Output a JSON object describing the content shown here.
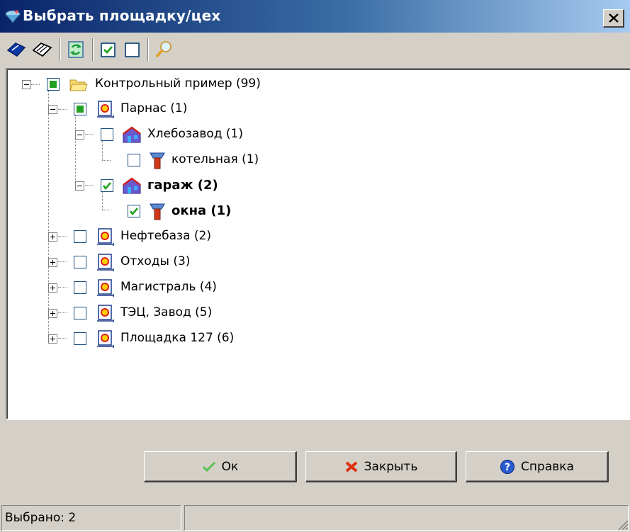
{
  "window": {
    "title": "Выбрать площадку/цех",
    "close_icon": "close-icon"
  },
  "toolbar": {
    "buttons": [
      {
        "name": "check-all-icon",
        "color": "#0a3aa8"
      },
      {
        "name": "uncheck-all-icon"
      },
      {
        "name": "refresh-icon",
        "color": "#1a9a3a"
      },
      {
        "name": "checkbox-checked-icon"
      },
      {
        "name": "checkbox-empty-icon"
      },
      {
        "name": "search-icon"
      }
    ]
  },
  "tree": {
    "nodes": [
      {
        "label": "Контрольный пример (99)",
        "level": 0,
        "expanded": true,
        "check": "partial",
        "icon": "folder-icon",
        "bold": false
      },
      {
        "label": "Парнас (1)",
        "level": 1,
        "expanded": true,
        "check": "partial",
        "icon": "site-icon",
        "bold": false
      },
      {
        "label": "Хлебозавод (1)",
        "level": 2,
        "expanded": true,
        "check": "unchecked",
        "icon": "building-icon",
        "bold": false
      },
      {
        "label": "котельная (1)",
        "level": 3,
        "expanded": null,
        "check": "unchecked",
        "icon": "pipe-icon",
        "bold": false
      },
      {
        "label": "гараж (2)",
        "level": 2,
        "expanded": true,
        "check": "checked",
        "icon": "building-icon",
        "bold": true
      },
      {
        "label": "окна (1)",
        "level": 3,
        "expanded": null,
        "check": "checked",
        "icon": "pipe-icon",
        "bold": true
      },
      {
        "label": "Нефтебаза (2)",
        "level": 1,
        "expanded": false,
        "check": "unchecked",
        "icon": "site-icon",
        "bold": false
      },
      {
        "label": "Отходы (3)",
        "level": 1,
        "expanded": false,
        "check": "unchecked",
        "icon": "site-icon",
        "bold": false
      },
      {
        "label": "Магистраль (4)",
        "level": 1,
        "expanded": false,
        "check": "unchecked",
        "icon": "site-icon",
        "bold": false
      },
      {
        "label": "ТЭЦ, Завод (5)",
        "level": 1,
        "expanded": false,
        "check": "unchecked",
        "icon": "site-icon",
        "bold": false
      },
      {
        "label": "Площадка 127 (6)",
        "level": 1,
        "expanded": false,
        "check": "unchecked",
        "icon": "site-icon",
        "bold": false
      }
    ]
  },
  "buttons": {
    "ok_label": "Ок",
    "close_label": "Закрыть",
    "help_label": "Справка"
  },
  "status": {
    "selected_text": "Выбрано: 2"
  },
  "colors": {
    "title_start": "#0a246a",
    "title_end": "#a6caf0",
    "check_green": "#21a121",
    "face": "#d4d0c8"
  }
}
